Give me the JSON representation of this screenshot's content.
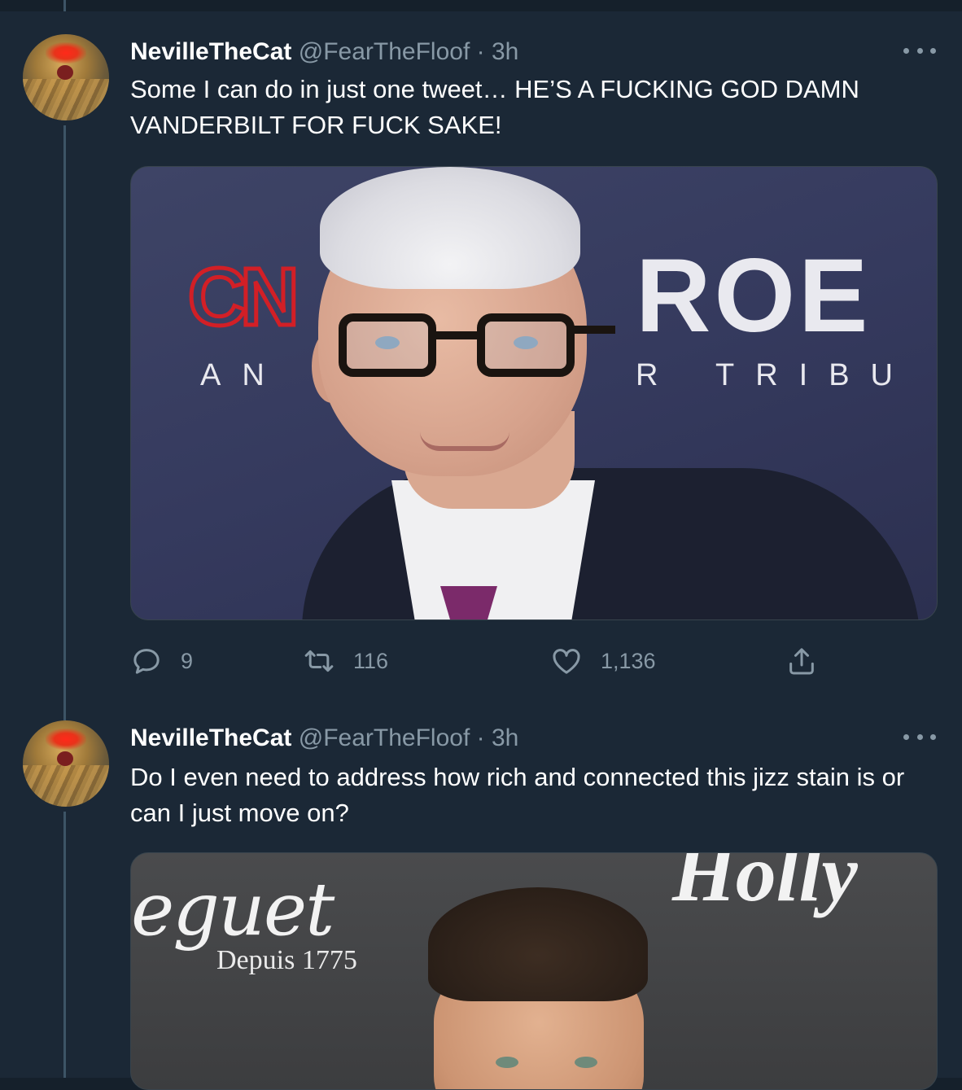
{
  "tweets": [
    {
      "author": {
        "name": "NevilleTheCat",
        "handle": "@FearTheFloof",
        "separator": "·",
        "time": "3h"
      },
      "text": "Some I can do in just one tweet… HE’S A FUCKING GOD DAMN VANDERBILT FOR FUCK SAKE!",
      "media_text": {
        "logo": "CN",
        "title": "ROE",
        "subline_left": "AN",
        "subline_middle": "R",
        "subline_right": "TRIBU"
      },
      "actions": {
        "reply_count": "9",
        "retweet_count": "116",
        "like_count": "1,136"
      }
    },
    {
      "author": {
        "name": "NevilleTheCat",
        "handle": "@FearTheFloof",
        "separator": "·",
        "time": "3h"
      },
      "text": "Do I even need to address how rich and connected this jizz stain is or can I just move on?",
      "media_text": {
        "brand": "eguet",
        "tagline": "Depuis 1775",
        "corner_text": "Holly"
      }
    }
  ],
  "icons": {
    "reply": "reply-icon",
    "retweet": "retweet-icon",
    "like": "like-icon",
    "share": "share-icon",
    "more": "more-options-icon"
  },
  "colors": {
    "background": "#15202b",
    "tweet_background": "#1b2836",
    "secondary_text": "#8899a6",
    "thread_line": "#3d5466"
  }
}
